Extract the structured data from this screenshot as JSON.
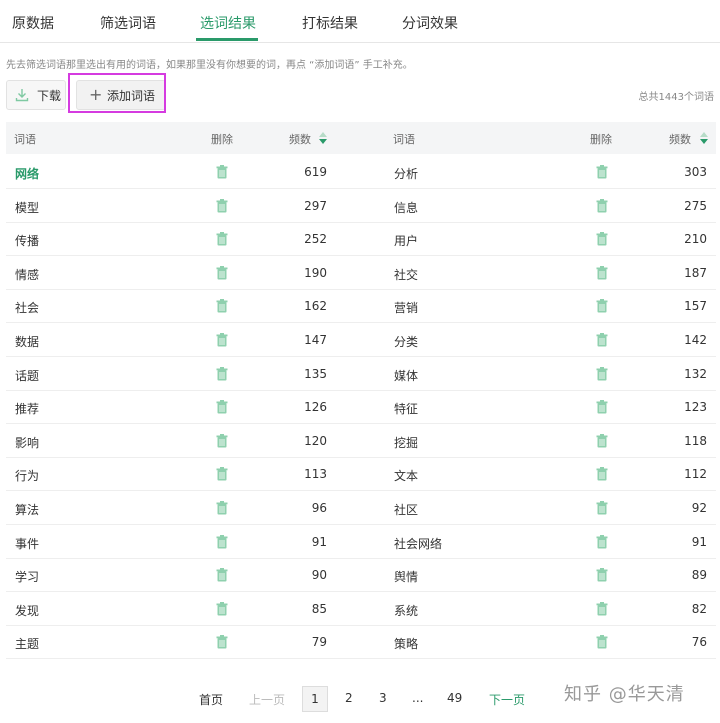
{
  "tabs": [
    {
      "label": "原数据",
      "active": false
    },
    {
      "label": "筛选词语",
      "active": false
    },
    {
      "label": "选词结果",
      "active": true
    },
    {
      "label": "打标结果",
      "active": false
    },
    {
      "label": "分词效果",
      "active": false
    }
  ],
  "hint": "先去筛选词语那里选出有用的词语，如果那里没有你想要的词，再点 “添加词语” 手工补充。",
  "toolbar": {
    "download_label": "下载",
    "add_label": "添加词语",
    "total": "总共1443个词语"
  },
  "table": {
    "headers": {
      "word": "词语",
      "delete": "删除",
      "freq": "频数"
    },
    "rows": [
      {
        "w1": "网络",
        "f1": "619",
        "w2": "分析",
        "f2": "303"
      },
      {
        "w1": "模型",
        "f1": "297",
        "w2": "信息",
        "f2": "275"
      },
      {
        "w1": "传播",
        "f1": "252",
        "w2": "用户",
        "f2": "210"
      },
      {
        "w1": "情感",
        "f1": "190",
        "w2": "社交",
        "f2": "187"
      },
      {
        "w1": "社会",
        "f1": "162",
        "w2": "营销",
        "f2": "157"
      },
      {
        "w1": "数据",
        "f1": "147",
        "w2": "分类",
        "f2": "142"
      },
      {
        "w1": "话题",
        "f1": "135",
        "w2": "媒体",
        "f2": "132"
      },
      {
        "w1": "推荐",
        "f1": "126",
        "w2": "特征",
        "f2": "123"
      },
      {
        "w1": "影响",
        "f1": "120",
        "w2": "挖掘",
        "f2": "118"
      },
      {
        "w1": "行为",
        "f1": "113",
        "w2": "文本",
        "f2": "112"
      },
      {
        "w1": "算法",
        "f1": "96",
        "w2": "社区",
        "f2": "92"
      },
      {
        "w1": "事件",
        "f1": "91",
        "w2": "社会网络",
        "f2": "91"
      },
      {
        "w1": "学习",
        "f1": "90",
        "w2": "舆情",
        "f2": "89"
      },
      {
        "w1": "发现",
        "f1": "85",
        "w2": "系统",
        "f2": "82"
      },
      {
        "w1": "主题",
        "f1": "79",
        "w2": "策略",
        "f2": "76"
      }
    ]
  },
  "pagination": {
    "first": "首页",
    "prev": "上一页",
    "pages": [
      "1",
      "2",
      "3",
      "...",
      "49"
    ],
    "current": "1",
    "next": "下一页"
  },
  "watermark": "知乎 @华天清",
  "colors": {
    "accent": "#2a9a6a",
    "highlight": "#d53be0",
    "trash": "#7fc9a2"
  }
}
